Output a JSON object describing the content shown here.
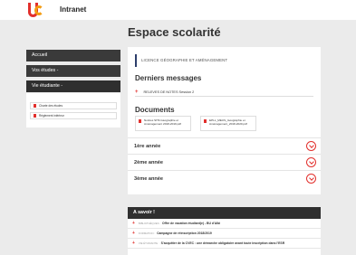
{
  "header": {
    "app_title": "Intranet"
  },
  "page": {
    "title": "Espace scolarité"
  },
  "sidebar": {
    "items": [
      {
        "label": "Accueil"
      },
      {
        "label": "Vos études -"
      },
      {
        "label": "Vie étudiante -"
      }
    ],
    "sub_links": [
      {
        "label": "Charte des études"
      },
      {
        "label": "Règlement intérieur"
      }
    ]
  },
  "main": {
    "breadcrumb": "LICENCE GÉOGRAPHIE ET AMÉNAGEMENT",
    "messages_title": "Derniers messages",
    "messages": [
      {
        "label": "RELEVES DE NOTES Session 2"
      }
    ],
    "documents_title": "Documents",
    "documents": [
      {
        "label": "Notices SHS Géographie et Aménagement 2018-2019.pdf"
      },
      {
        "label": "EPLL_MEUS_Géographie et Aménagement_2018-2020.pdf"
      }
    ],
    "years": [
      {
        "label": "1ère année"
      },
      {
        "label": "2ème année"
      },
      {
        "label": "3ème année"
      }
    ]
  },
  "savoir": {
    "title": "A savoir !",
    "items": [
      {
        "category": "BIBLIOTHÈQUES :",
        "text": "Offre de vacation étudiant(e) - BU d'Albi"
      },
      {
        "category": "FORMATION :",
        "text": "Campagne de réinscription 2018/2019"
      },
      {
        "category": "VIE ÉTUDIANTE :",
        "text": "S'acquitter de la CVEC : une démarche obligatoire avant toute inscription dans l'ESR"
      }
    ]
  },
  "colors": {
    "accent": "#e2302d",
    "nav_bg": "#3a3a3a",
    "page_bg": "#ebebeb"
  }
}
